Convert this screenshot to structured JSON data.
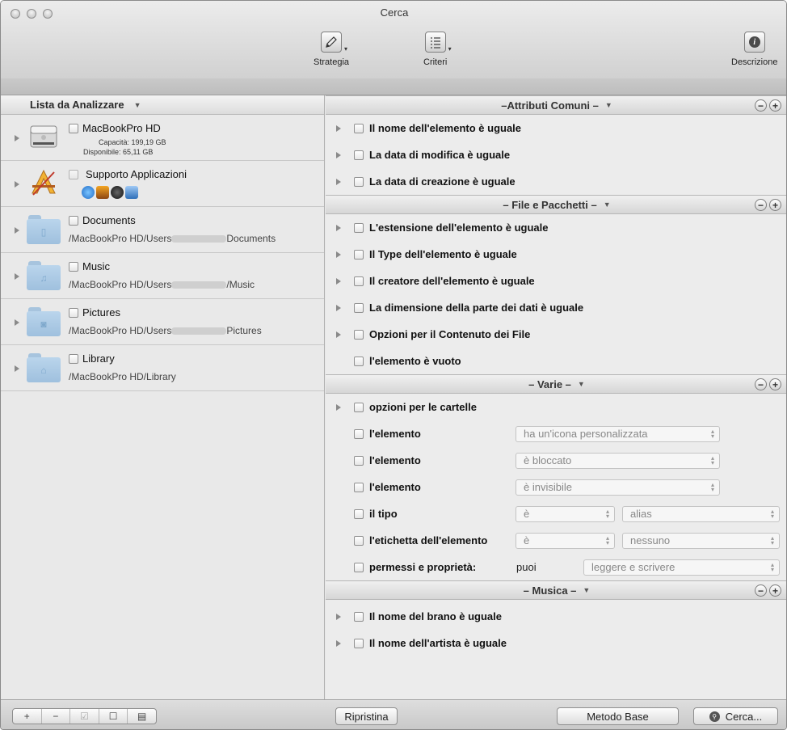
{
  "window": {
    "title": "Cerca"
  },
  "toolbar": {
    "strategia": "Strategia",
    "criteri": "Criteri",
    "descrizione": "Descrizione"
  },
  "left": {
    "header": "Lista da Analizzare",
    "items": [
      {
        "name": "MacBookPro HD",
        "capacity": "Capacità: 199,19 GB",
        "available": "Disponibile: 65,11 GB"
      },
      {
        "name": "Supporto Applicazioni"
      },
      {
        "name": "Documents",
        "path_a": "/MacBookPro HD/Users",
        "path_b": "Documents"
      },
      {
        "name": "Music",
        "path_a": "/MacBookPro HD/Users",
        "path_b": "/Music"
      },
      {
        "name": "Pictures",
        "path_a": "/MacBookPro HD/Users",
        "path_b": "Pictures"
      },
      {
        "name": "Library",
        "path_a": "/MacBookPro HD/Library"
      }
    ]
  },
  "sections": {
    "attributi": {
      "title": "–Attributi Comuni –",
      "rows": [
        "Il nome dell'elemento è uguale",
        "La data di modifica è uguale",
        "La data di creazione è uguale"
      ]
    },
    "file": {
      "title": "– File e Pacchetti –",
      "rows": [
        "L'estensione dell'elemento è uguale",
        "Il Type dell'elemento è uguale",
        "Il creatore dell'elemento è uguale",
        "La dimensione della parte dei dati è uguale",
        "Opzioni per il Contenuto dei File",
        "l'elemento è vuoto"
      ]
    },
    "varie": {
      "title": "– Varie –",
      "rows": {
        "cartelle": "opzioni per le cartelle",
        "el1": "l'elemento",
        "el1_val": "ha un'icona personalizzata",
        "el2": "l'elemento",
        "el2_val": "è bloccato",
        "el3": "l'elemento",
        "el3_val": "è invisibile",
        "tipo": "il tipo",
        "tipo_op": "è",
        "tipo_val": "alias",
        "etichetta": "l'etichetta dell'elemento",
        "etichetta_op": "è",
        "etichetta_val": "nessuno",
        "permessi": "permessi e proprietà:",
        "puoi": "puoi",
        "permessi_val": "leggere e scrivere"
      }
    },
    "musica": {
      "title": "– Musica –",
      "rows": [
        "Il nome del brano è uguale",
        "Il nome dell'artista è uguale"
      ]
    }
  },
  "footer": {
    "ripristina": "Ripristina",
    "metodo": "Metodo Base",
    "cerca": "Cerca..."
  }
}
